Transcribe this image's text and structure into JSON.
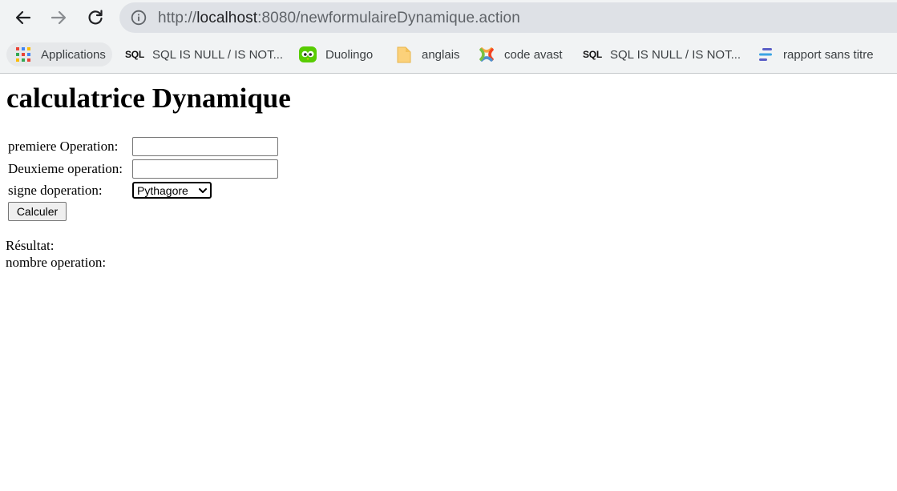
{
  "browser": {
    "url_prefix": "http://",
    "url_host": "localhost",
    "url_rest": ":8080/newformulaireDynamique.action"
  },
  "bookmarks": [
    {
      "label": "Applications",
      "icon": "apps-grid-icon"
    },
    {
      "label": "SQL IS NULL / IS NOT...",
      "icon": "sql-icon",
      "icon_text": "SQL"
    },
    {
      "label": "Duolingo",
      "icon": "duolingo-icon"
    },
    {
      "label": "anglais",
      "icon": "folder-icon"
    },
    {
      "label": "code avast",
      "icon": "joomla-icon"
    },
    {
      "label": "SQL IS NULL / IS NOT...",
      "icon": "sql-icon",
      "icon_text": "SQL"
    },
    {
      "label": "rapport sans titre",
      "icon": "lines-icon"
    }
  ],
  "page": {
    "title": "calculatrice Dynamique",
    "form": {
      "first_label": "premiere Operation:",
      "first_value": "",
      "second_label": "Deuxieme operation:",
      "second_value": "",
      "sign_label": "signe doperation:",
      "sign_selected": "Pythagore",
      "submit_label": "Calculer"
    },
    "result_label": "Résultat:",
    "count_label": "nombre operation:"
  }
}
